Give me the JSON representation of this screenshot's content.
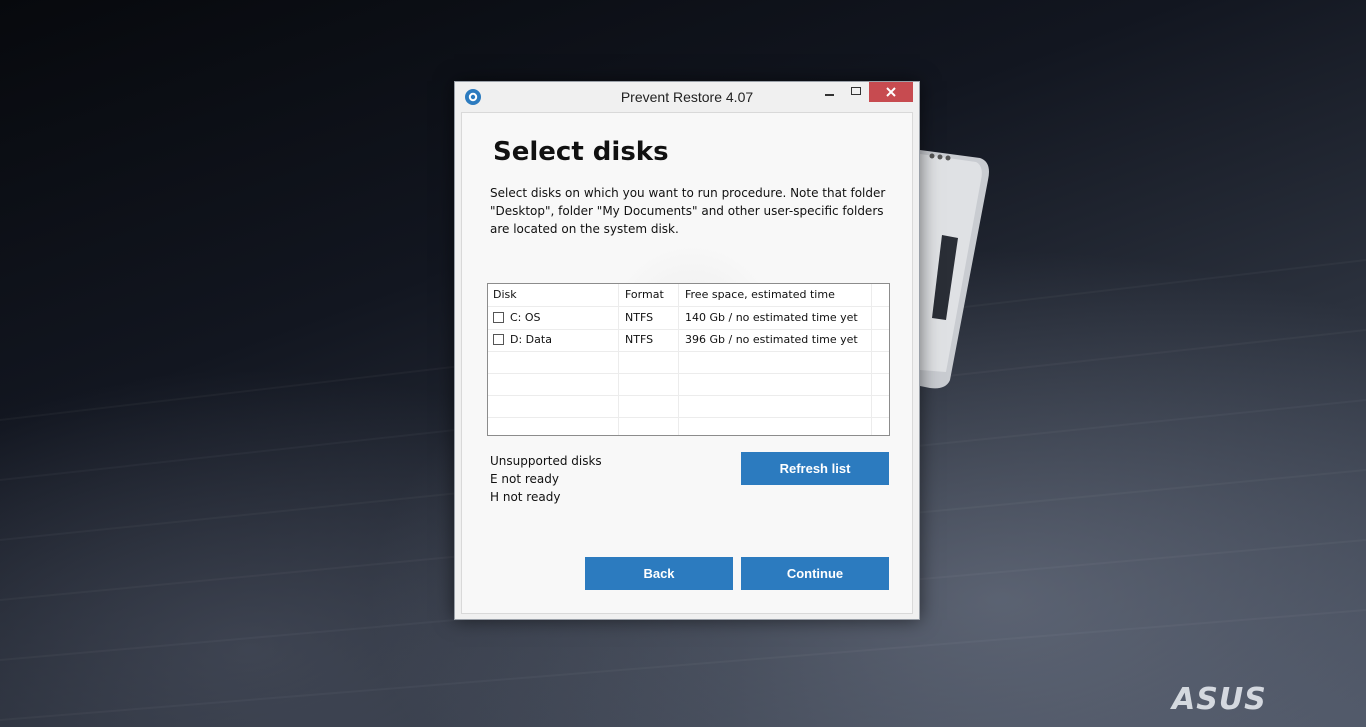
{
  "window": {
    "title": "Prevent Restore 4.07"
  },
  "page": {
    "heading": "Select disks",
    "description": "Select disks on which you want to run procedure. Note that folder \"Desktop\", folder \"My Documents\" and other user-specific folders are located on the system disk."
  },
  "table": {
    "headers": {
      "disk": "Disk",
      "format": "Format",
      "free": "Free space, estimated time"
    },
    "rows": [
      {
        "disk": "C: OS",
        "format": "NTFS",
        "free": "140 Gb / no estimated time yet",
        "checked": false
      },
      {
        "disk": "D: Data",
        "format": "NTFS",
        "free": "396 Gb / no estimated time yet",
        "checked": false
      }
    ]
  },
  "unsupported": {
    "title": "Unsupported disks",
    "items": [
      "E not ready",
      "H not ready"
    ]
  },
  "buttons": {
    "refresh": "Refresh list",
    "back": "Back",
    "continue": "Continue"
  },
  "branding": {
    "logo": "ASUS"
  },
  "colors": {
    "accent": "#2c7bbf",
    "close": "#c74b50"
  }
}
